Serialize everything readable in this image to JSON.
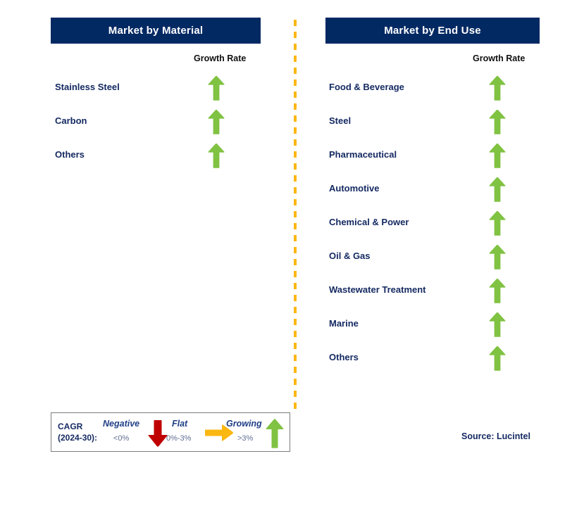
{
  "panels": [
    {
      "id": "material",
      "title": "Market by Material",
      "growth_rate_label": "Growth Rate",
      "rows": [
        {
          "label": "Stainless Steel",
          "growth": "growing",
          "icon": "up-arrow-icon"
        },
        {
          "label": "Carbon",
          "growth": "growing",
          "icon": "up-arrow-icon"
        },
        {
          "label": "Others",
          "growth": "growing",
          "icon": "up-arrow-icon"
        }
      ]
    },
    {
      "id": "enduse",
      "title": "Market by End Use",
      "growth_rate_label": "Growth Rate",
      "rows": [
        {
          "label": "Food & Beverage",
          "growth": "growing",
          "icon": "up-arrow-icon"
        },
        {
          "label": "Steel",
          "growth": "growing",
          "icon": "up-arrow-icon"
        },
        {
          "label": "Pharmaceutical",
          "growth": "growing",
          "icon": "up-arrow-icon"
        },
        {
          "label": "Automotive",
          "growth": "growing",
          "icon": "up-arrow-icon"
        },
        {
          "label": "Chemical & Power",
          "growth": "growing",
          "icon": "up-arrow-icon"
        },
        {
          "label": "Oil & Gas",
          "growth": "growing",
          "icon": "up-arrow-icon"
        },
        {
          "label": "Wastewater Treatment",
          "growth": "growing",
          "icon": "up-arrow-icon"
        },
        {
          "label": "Marine",
          "growth": "growing",
          "icon": "up-arrow-icon"
        },
        {
          "label": "Others",
          "growth": "growing",
          "icon": "up-arrow-icon"
        }
      ]
    }
  ],
  "legend": {
    "cagr_label": "CAGR\n(2024-30):",
    "items": [
      {
        "name": "Negative",
        "range": "<0%",
        "icon": "down-arrow-icon",
        "color": "#C00000"
      },
      {
        "name": "Flat",
        "range": "0%-3%",
        "icon": "right-arrow-icon",
        "color": "#FBB712"
      },
      {
        "name": "Growing",
        "range": ">3%",
        "icon": "up-arrow-icon",
        "color": "#80C242"
      }
    ]
  },
  "source": "Source: Lucintel",
  "colors": {
    "header_navy": "#032963",
    "label_navy": "#152a62",
    "growing_green": "#80C242",
    "negative_red": "#C00000",
    "flat_orange": "#FBB712",
    "divider_orange": "#FBB712",
    "legend_border": "#7c7c7c"
  }
}
